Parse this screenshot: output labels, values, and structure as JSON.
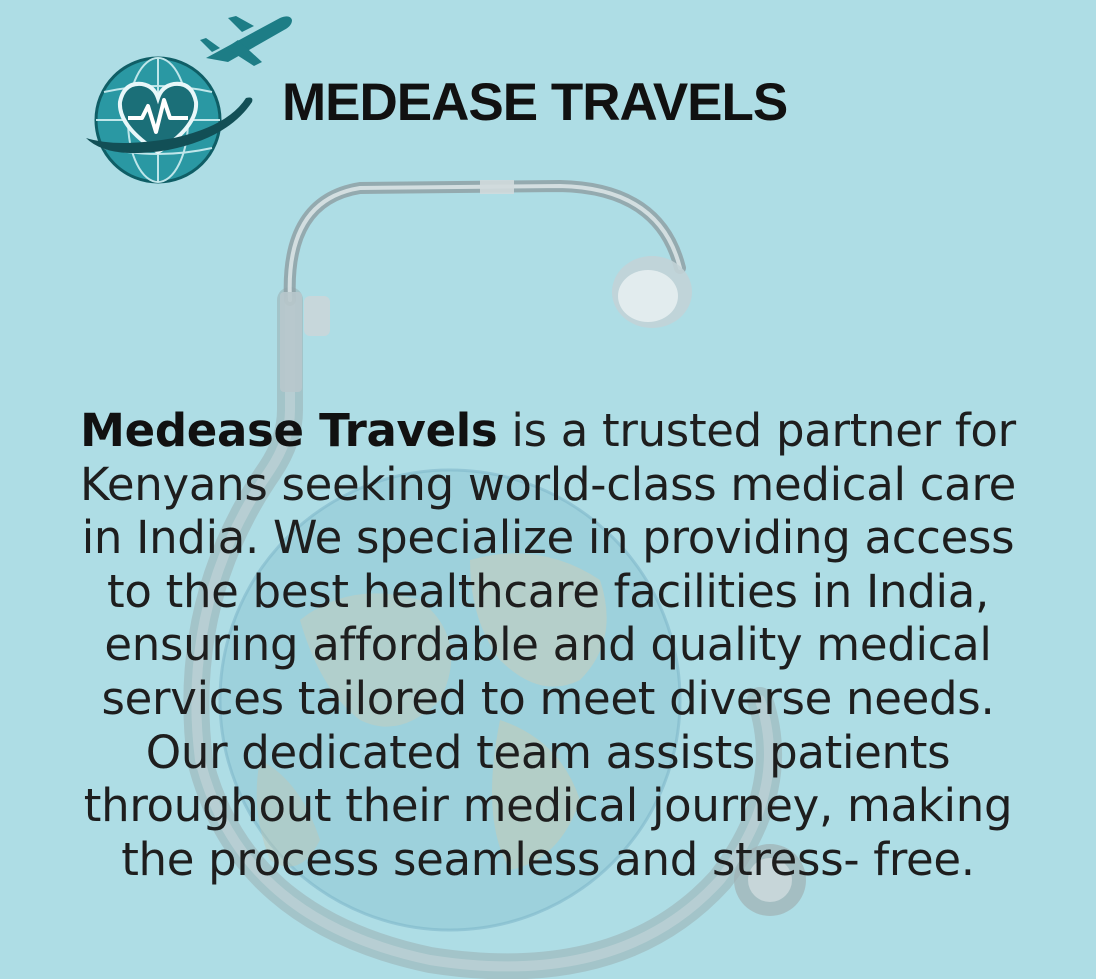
{
  "brand": {
    "title": "MEDEASE TRAVELS",
    "logo_icon": "globe-heartbeat-plane-logo"
  },
  "description": {
    "line1_bold": "Medease Travels",
    "line1_rest": " is a trusted partner for",
    "line2": "Kenyans seeking world-class medical care",
    "line3": "in India. We specialize in providing access",
    "line4": "to the best healthcare facilities in India,",
    "line5": "ensuring affordable and quality medical",
    "line6": "services tailored to meet diverse needs.",
    "line7": "Our dedicated team assists patients",
    "line8": "throughout their medical journey, making",
    "line9": "the process seamless and stress- free."
  },
  "background": {
    "icon": "stethoscope-globe-illustration"
  },
  "colors": {
    "background": "#aedde5",
    "logo_teal": "#1e8a96",
    "text": "#1e1e1e"
  }
}
